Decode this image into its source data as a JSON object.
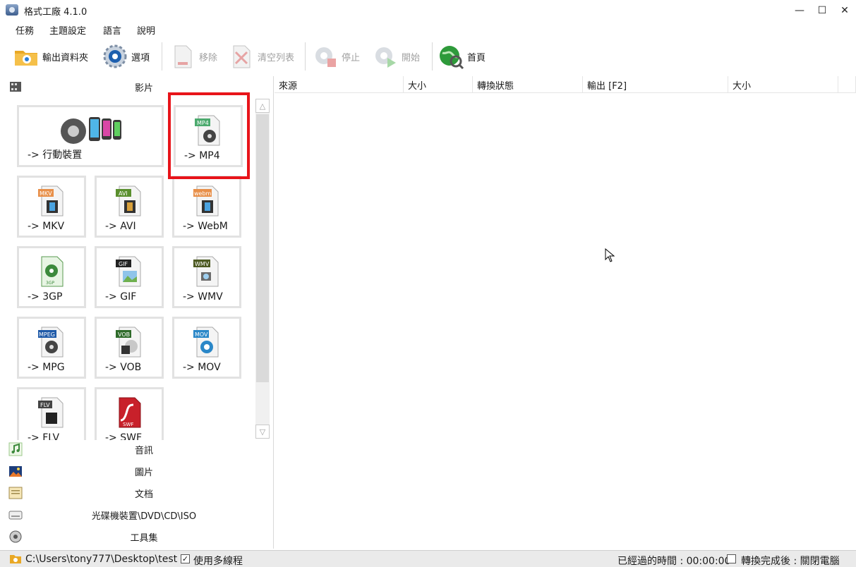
{
  "window": {
    "title": "格式工廠 4.1.0",
    "minimize": "—",
    "maximize": "☐",
    "close": "✕"
  },
  "menu": [
    "任務",
    "主題設定",
    "語言",
    "說明"
  ],
  "toolbar": {
    "output_folder": "輸出資料夾",
    "options": "選項",
    "remove": "移除",
    "clear_list": "清空列表",
    "stop": "停止",
    "start": "開始",
    "home": "首頁"
  },
  "categories": {
    "video": "影片",
    "audio": "音訊",
    "image": "圖片",
    "document": "文档",
    "disc": "光碟機裝置\\DVD\\CD\\ISO",
    "tools": "工具集"
  },
  "tiles": [
    {
      "label": "-> 行動裝置",
      "badge": ""
    },
    {
      "label": "-> MP4",
      "badge": "MP4"
    },
    {
      "label": "-> MKV",
      "badge": "MKV"
    },
    {
      "label": "-> AVI",
      "badge": "AVI"
    },
    {
      "label": "-> WebM",
      "badge": "webm"
    },
    {
      "label": "-> 3GP",
      "badge": "3GP"
    },
    {
      "label": "-> GIF",
      "badge": "GIF"
    },
    {
      "label": "-> WMV",
      "badge": "WMV"
    },
    {
      "label": "-> MPG",
      "badge": "MPEG"
    },
    {
      "label": "-> VOB",
      "badge": "VOB"
    },
    {
      "label": "-> MOV",
      "badge": "MOV"
    },
    {
      "label": "-> FLV",
      "badge": "FLV"
    },
    {
      "label": "-> SWF",
      "badge": "SWF"
    }
  ],
  "scroll": {
    "up": "△",
    "down": "▽"
  },
  "list": {
    "columns": [
      "來源",
      "大小",
      "轉換狀態",
      "輸出 [F2]",
      "大小"
    ]
  },
  "status": {
    "path": "C:\\Users\\tony777\\Desktop\\test",
    "multithread_checked": "✓",
    "multithread": "使用多線程",
    "elapsed": "已經過的時間 : 00:00:00",
    "after_done": "轉換完成後 : 關閉電腦"
  },
  "colors": {
    "highlight": "#e8141a",
    "accent_green": "#2e9a3a"
  }
}
